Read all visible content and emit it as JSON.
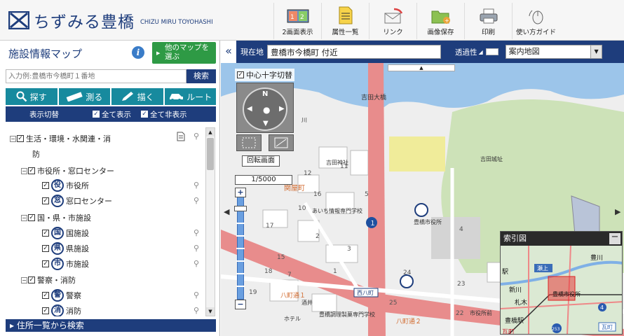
{
  "app": {
    "title_jp": "ちずみる豊橋",
    "title_en": "CHIZU MIRU TOYOHASHI"
  },
  "toolbar": [
    {
      "label": "2画面表示",
      "icon": "dual-screen-icon"
    },
    {
      "label": "属性一覧",
      "icon": "document-list-icon"
    },
    {
      "label": "リンク",
      "icon": "mail-link-icon"
    },
    {
      "label": "画像保存",
      "icon": "folder-save-icon"
    },
    {
      "label": "印刷",
      "icon": "printer-icon"
    },
    {
      "label": "使い方ガイド",
      "icon": "mouse-guide-icon"
    }
  ],
  "sidebar": {
    "title": "施設情報マップ",
    "other_map_label": "他のマップを選ぶ",
    "search_placeholder": "入力例:豊橋市今橋町１番地",
    "search_button": "検索",
    "tools": [
      {
        "label": "探す",
        "icon": "magnifier-icon"
      },
      {
        "label": "測る",
        "icon": "ruler-icon"
      },
      {
        "label": "描く",
        "icon": "pen-icon"
      },
      {
        "label": "ルート",
        "icon": "car-route-icon"
      }
    ],
    "toggle_label": "表示切替",
    "show_all": "全て表示",
    "hide_all": "全て非表示",
    "address_list": "住所一覧から検索"
  },
  "tree": [
    {
      "label": "生活・環境・水関連・消",
      "level": 0,
      "expander": "-"
    },
    {
      "label": "防",
      "level": 0,
      "continuation": true
    },
    {
      "label": "市役所・窓口センター",
      "level": 1,
      "expander": "-"
    },
    {
      "label": "市役所",
      "level": 2,
      "badge": "役"
    },
    {
      "label": "窓口センター",
      "level": 2,
      "badge": "窓"
    },
    {
      "label": "国・県・市施設",
      "level": 1,
      "expander": "-"
    },
    {
      "label": "国施設",
      "level": 2,
      "badge": "国"
    },
    {
      "label": "県施設",
      "level": 2,
      "badge": "県"
    },
    {
      "label": "市施設",
      "level": 2,
      "badge": "市"
    },
    {
      "label": "警察・消防",
      "level": 1,
      "expander": "-"
    },
    {
      "label": "警察",
      "level": 2,
      "badge": "警"
    },
    {
      "label": "消防",
      "level": 2,
      "badge": "消"
    }
  ],
  "map": {
    "location_label": "現在地",
    "location_value": "豊橋市今橋町 付近",
    "transparency_label": "透過性",
    "map_select_value": "案内地図",
    "center_cross_label": "中心十字切替",
    "rotate_label": "回転画面",
    "scale": "1/5000",
    "compass_n": "N",
    "labels": [
      "関屋町",
      "吉田大橋",
      "吉田神社",
      "吉田城址",
      "あいち情報専門学校",
      "豊橋市役所",
      "八町通１",
      "八町通２",
      "西八町",
      "豊橋市役所",
      "市役所前",
      "ホテル",
      "豊橋調理製菓専門学校",
      "川",
      "酒井",
      "１"
    ],
    "labels_num": [
      "12",
      "16",
      "17",
      "10",
      "5",
      "2",
      "3",
      "1",
      "4",
      "15",
      "7",
      "22",
      "23",
      "24",
      "25",
      "11",
      "18",
      "19"
    ]
  },
  "inset": {
    "title": "索引図",
    "labels": [
      "豊川",
      "瀬上",
      "新豊橋",
      "豊橋市役所",
      "豊橋駅",
      "瓦町",
      "新川",
      "駅",
      "札木",
      "4",
      "253"
    ]
  },
  "colors": {
    "navy": "#1e3d7c",
    "teal": "#178a9e",
    "green": "#2e9a45",
    "road": "#e88c8c",
    "water": "#9cc5ea"
  }
}
